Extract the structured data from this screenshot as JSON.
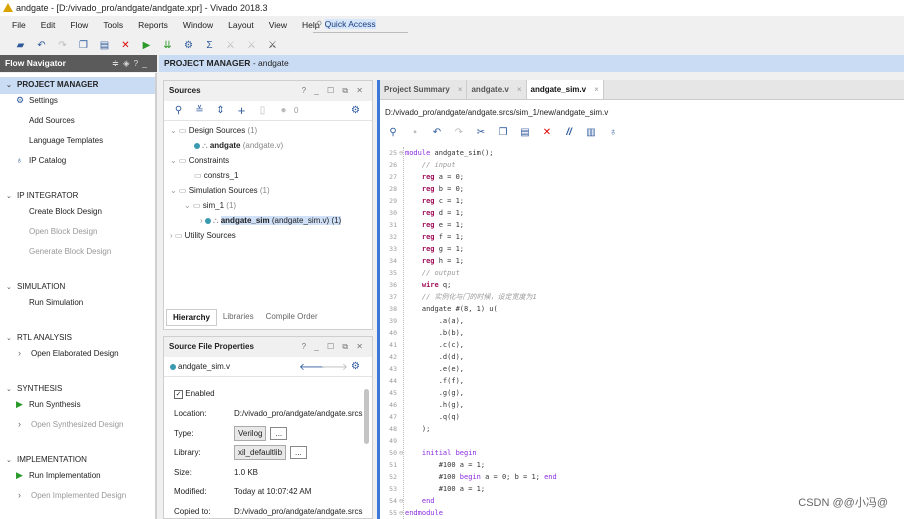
{
  "window": {
    "title": "andgate - [D:/vivado_pro/andgate/andgate.xpr] - Vivado 2018.3"
  },
  "menu": [
    "File",
    "Edit",
    "Flow",
    "Tools",
    "Reports",
    "Window",
    "Layout",
    "View",
    "Help"
  ],
  "quick_access": "Quick Access",
  "toolbar_icons": [
    "open-project-icon",
    "undo-icon",
    "redo-icon",
    "copy-icon",
    "paste-icon",
    "delete-icon",
    "run-icon",
    "program-icon",
    "settings-icon",
    "sigma-icon",
    "disabled-tool-icon",
    "disabled-tool-icon",
    "auto-connect-icon"
  ],
  "flow_navigator": {
    "title": "Flow Navigator",
    "sections": [
      {
        "label": "PROJECT MANAGER",
        "items": [
          {
            "label": "Settings",
            "icon": "gear"
          },
          {
            "label": "Add Sources"
          },
          {
            "label": "Language Templates"
          },
          {
            "label": "IP Catalog",
            "icon": "ip"
          }
        ]
      },
      {
        "label": "IP INTEGRATOR",
        "items": [
          {
            "label": "Create Block Design"
          },
          {
            "label": "Open Block Design",
            "disabled": true
          },
          {
            "label": "Generate Block Design",
            "disabled": true
          }
        ]
      },
      {
        "label": "SIMULATION",
        "items": [
          {
            "label": "Run Simulation"
          }
        ]
      },
      {
        "label": "RTL ANALYSIS",
        "items": [
          {
            "label": "Open Elaborated Design",
            "expand": true
          }
        ]
      },
      {
        "label": "SYNTHESIS",
        "items": [
          {
            "label": "Run Synthesis",
            "icon": "run"
          },
          {
            "label": "Open Synthesized Design",
            "expand": true,
            "disabled": true
          }
        ]
      },
      {
        "label": "IMPLEMENTATION",
        "items": [
          {
            "label": "Run Implementation",
            "icon": "run"
          },
          {
            "label": "Open Implemented Design",
            "expand": true,
            "disabled": true
          }
        ]
      }
    ]
  },
  "header": {
    "title": "PROJECT MANAGER",
    "project": "- andgate"
  },
  "sources": {
    "title": "Sources",
    "count": "0",
    "tree": {
      "design_sources": "Design Sources",
      "design_count": "(1)",
      "andgate": "andgate",
      "andgate_file": "(andgate.v)",
      "constraints": "Constraints",
      "constrs": "constrs_1",
      "sim_sources": "Simulation Sources",
      "sim_count": "(1)",
      "sim_1": "sim_1",
      "sim_1_count": "(1)",
      "andgate_sim": "andgate_sim",
      "andgate_sim_file": "(andgate_sim.v) (1)",
      "utility": "Utility Sources"
    },
    "tabs": [
      "Hierarchy",
      "Libraries",
      "Compile Order"
    ]
  },
  "properties": {
    "title": "Source File Properties",
    "file": "andgate_sim.v",
    "enabled": "Enabled",
    "rows": [
      {
        "k": "Location:",
        "v": "D:/vivado_pro/andgate/andgate.srcs"
      },
      {
        "k": "Type:",
        "v": "Verilog"
      },
      {
        "k": "Library:",
        "v": "xil_defaultlib"
      },
      {
        "k": "Size:",
        "v": "1.0 KB"
      },
      {
        "k": "Modified:",
        "v": "Today at 10:07:42 AM"
      },
      {
        "k": "Copied to:",
        "v": "D:/vivado_pro/andgate/andgate.srcs"
      }
    ],
    "more": "..."
  },
  "editor": {
    "tabs": [
      "Project Summary",
      "andgate.v",
      "andgate_sim.v"
    ],
    "path": "D:/vivado_pro/andgate/andgate.srcs/sim_1/new/andgate_sim.v",
    "lines": [
      {
        "n": "25",
        "f": true,
        "t": [
          [
            "kw2",
            "module"
          ],
          [
            "tx",
            " andgate_sim();"
          ]
        ]
      },
      {
        "n": "26",
        "t": [
          [
            "cm",
            "    // input"
          ]
        ]
      },
      {
        "n": "27",
        "t": [
          [
            "kw",
            "    reg"
          ],
          [
            "tx",
            " a = 0;"
          ]
        ]
      },
      {
        "n": "28",
        "t": [
          [
            "kw",
            "    reg"
          ],
          [
            "tx",
            " b = 0;"
          ]
        ]
      },
      {
        "n": "29",
        "t": [
          [
            "kw",
            "    reg"
          ],
          [
            "tx",
            " c = 1;"
          ]
        ]
      },
      {
        "n": "30",
        "t": [
          [
            "kw",
            "    reg"
          ],
          [
            "tx",
            " d = 1;"
          ]
        ]
      },
      {
        "n": "31",
        "t": [
          [
            "kw",
            "    reg"
          ],
          [
            "tx",
            " e = 1;"
          ]
        ]
      },
      {
        "n": "32",
        "t": [
          [
            "kw",
            "    reg"
          ],
          [
            "tx",
            " f = 1;"
          ]
        ]
      },
      {
        "n": "33",
        "t": [
          [
            "kw",
            "    reg"
          ],
          [
            "tx",
            " g = 1;"
          ]
        ]
      },
      {
        "n": "34",
        "t": [
          [
            "kw",
            "    reg"
          ],
          [
            "tx",
            " h = 1;"
          ]
        ]
      },
      {
        "n": "35",
        "t": [
          [
            "cm",
            "    // output"
          ]
        ]
      },
      {
        "n": "36",
        "t": [
          [
            "kw",
            "    wire"
          ],
          [
            "tx",
            " q;"
          ]
        ]
      },
      {
        "n": "37",
        "t": [
          [
            "cm",
            "    // 实例化与门的时候，设定宽度为1"
          ]
        ]
      },
      {
        "n": "38",
        "t": [
          [
            "tx",
            "    andgate #(8, 1) u("
          ]
        ]
      },
      {
        "n": "39",
        "t": [
          [
            "tx",
            "        .a(a),"
          ]
        ]
      },
      {
        "n": "40",
        "t": [
          [
            "tx",
            "        .b(b),"
          ]
        ]
      },
      {
        "n": "41",
        "t": [
          [
            "tx",
            "        .c(c),"
          ]
        ]
      },
      {
        "n": "42",
        "t": [
          [
            "tx",
            "        .d(d),"
          ]
        ]
      },
      {
        "n": "43",
        "t": [
          [
            "tx",
            "        .e(e),"
          ]
        ]
      },
      {
        "n": "44",
        "t": [
          [
            "tx",
            "        .f(f),"
          ]
        ]
      },
      {
        "n": "45",
        "t": [
          [
            "tx",
            "        .g(g),"
          ]
        ]
      },
      {
        "n": "46",
        "t": [
          [
            "tx",
            "        .h(g),"
          ]
        ]
      },
      {
        "n": "47",
        "t": [
          [
            "tx",
            "        .q(q)"
          ]
        ]
      },
      {
        "n": "48",
        "t": [
          [
            "tx",
            "    );"
          ]
        ]
      },
      {
        "n": "49",
        "t": []
      },
      {
        "n": "50",
        "f": true,
        "t": [
          [
            "kw2",
            "    initial begin"
          ]
        ]
      },
      {
        "n": "51",
        "t": [
          [
            "tx",
            "        #100 a = 1;"
          ]
        ]
      },
      {
        "n": "52",
        "t": [
          [
            "tx",
            "        #100 "
          ],
          [
            "kw2",
            "begin"
          ],
          [
            "tx",
            " a = 0; b = 1; "
          ],
          [
            "kw2",
            "end"
          ]
        ]
      },
      {
        "n": "53",
        "t": [
          [
            "tx",
            "        #100 a = 1;"
          ]
        ]
      },
      {
        "n": "54",
        "f": true,
        "t": [
          [
            "kw2",
            "    end"
          ]
        ]
      },
      {
        "n": "55",
        "f": true,
        "t": [
          [
            "kw2",
            "endmodule"
          ]
        ]
      }
    ]
  },
  "watermark": "CSDN @@小冯@"
}
